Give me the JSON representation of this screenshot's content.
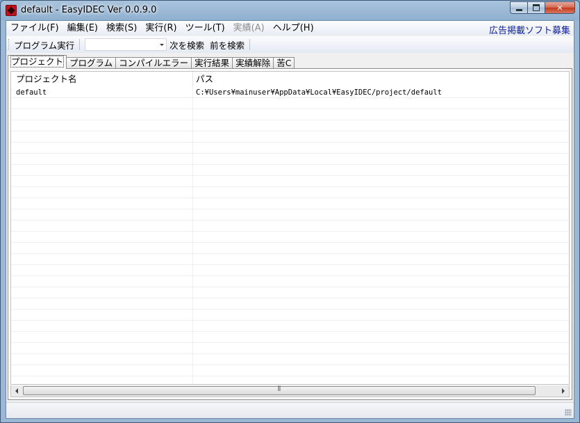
{
  "window": {
    "title": "default - EasyIDEC Ver 0.0.9.0",
    "icon": "app-icon"
  },
  "menubar": {
    "items": [
      {
        "label": "ファイル(F)",
        "enabled": true
      },
      {
        "label": "編集(E)",
        "enabled": true
      },
      {
        "label": "検索(S)",
        "enabled": true
      },
      {
        "label": "実行(R)",
        "enabled": true
      },
      {
        "label": "ツール(T)",
        "enabled": true
      },
      {
        "label": "実績(A)",
        "enabled": false
      },
      {
        "label": "ヘルプ(H)",
        "enabled": true
      }
    ],
    "ad_link": "広告掲載ソフト募集"
  },
  "toolbar": {
    "run_program": "プログラム実行",
    "combo_value": "",
    "find_next": "次を検索",
    "find_prev": "前を検索"
  },
  "tabs": [
    {
      "label": "プロジェクト",
      "active": true
    },
    {
      "label": "プログラム",
      "active": false
    },
    {
      "label": "コンパイルエラー",
      "active": false
    },
    {
      "label": "実行結果",
      "active": false
    },
    {
      "label": "実績解除",
      "active": false
    },
    {
      "label": "苦C",
      "active": false
    }
  ],
  "project_list": {
    "columns": [
      "プロジェクト名",
      "パス"
    ],
    "rows": [
      {
        "name": "default",
        "path": "C:¥Users¥mainuser¥AppData¥Local¥EasyIDEC/project/default"
      }
    ]
  },
  "scrollbar": {
    "grip": "Ⅲ"
  },
  "colors": {
    "ad_link": "#0b1c99",
    "disabled_menu": "#8d8d8d",
    "close_button": "#c2391e"
  }
}
